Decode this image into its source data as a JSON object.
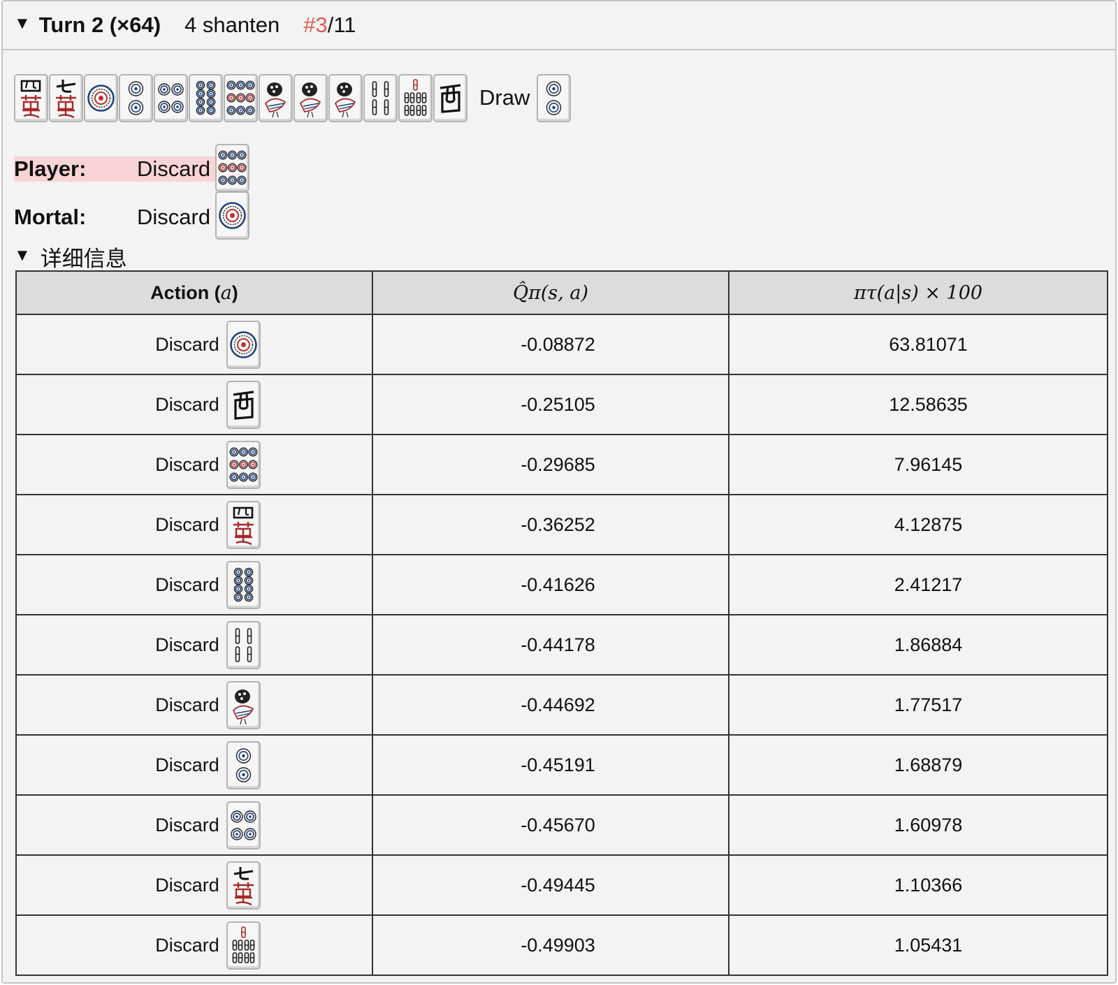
{
  "header": {
    "turn_label": "Turn 2 (×64)",
    "shanten": "4 shanten",
    "rank_prefix": "#",
    "rank_num": "3",
    "rank_total": "/11"
  },
  "hand": {
    "tiles": [
      "4m",
      "7m",
      "1p",
      "2p",
      "4p",
      "8p",
      "9p",
      "1s",
      "1s",
      "1s",
      "4s",
      "7s",
      "west"
    ],
    "draw_label": "Draw",
    "draw_tile": "2p"
  },
  "player": {
    "label": "Player:",
    "action": "Discard",
    "tile": "9p"
  },
  "mortal": {
    "label": "Mortal:",
    "action": "Discard",
    "tile": "1p"
  },
  "details": {
    "label": "详细信息"
  },
  "table": {
    "headers": [
      "Action (a)",
      "Q̂π(s, a)",
      "πτ(a|s) × 100"
    ],
    "header_action_text": "Action (",
    "header_action_var": "a",
    "header_action_close": ")",
    "rows": [
      {
        "action": "Discard",
        "tile": "1p",
        "q": "-0.08872",
        "p": "63.81071"
      },
      {
        "action": "Discard",
        "tile": "west",
        "q": "-0.25105",
        "p": "12.58635"
      },
      {
        "action": "Discard",
        "tile": "9p",
        "q": "-0.29685",
        "p": "7.96145"
      },
      {
        "action": "Discard",
        "tile": "4m",
        "q": "-0.36252",
        "p": "4.12875"
      },
      {
        "action": "Discard",
        "tile": "8p",
        "q": "-0.41626",
        "p": "2.41217"
      },
      {
        "action": "Discard",
        "tile": "4s",
        "q": "-0.44178",
        "p": "1.86884"
      },
      {
        "action": "Discard",
        "tile": "1s",
        "q": "-0.44692",
        "p": "1.77517"
      },
      {
        "action": "Discard",
        "tile": "2p",
        "q": "-0.45191",
        "p": "1.68879"
      },
      {
        "action": "Discard",
        "tile": "4p",
        "q": "-0.45670",
        "p": "1.60978"
      },
      {
        "action": "Discard",
        "tile": "7m",
        "q": "-0.49445",
        "p": "1.10366"
      },
      {
        "action": "Discard",
        "tile": "7s",
        "q": "-0.49903",
        "p": "1.05431"
      }
    ]
  },
  "colors": {
    "highlight": "#f8d4d6",
    "rank": "#e05a52",
    "man_red": "#a8282a",
    "pin_blue": "#1c3f7a"
  }
}
